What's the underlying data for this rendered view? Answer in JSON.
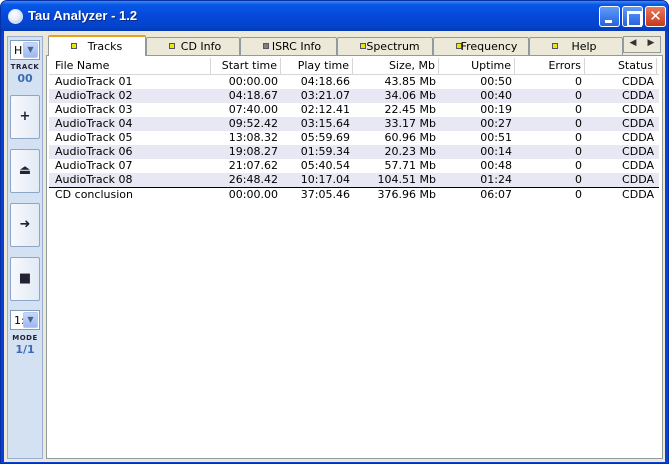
{
  "window": {
    "title": "Tau Analyzer - 1.2"
  },
  "titlebar": {
    "close_glyph": "✕"
  },
  "side": {
    "track_combo": "H",
    "track_label": "TRACK",
    "track_value": "00",
    "buttons": [
      {
        "glyph": "+",
        "icon": "plus-icon"
      },
      {
        "glyph": "⏏",
        "icon": "eject-icon"
      },
      {
        "glyph": "➜",
        "icon": "next-arrow-icon"
      },
      {
        "glyph": "■",
        "icon": "stop-icon"
      }
    ],
    "mode_combo": "1:",
    "mode_label": "MODE",
    "mode_value": "1/1"
  },
  "tabs": [
    {
      "label": "Tracks",
      "indicator": "#e8e800",
      "active": true
    },
    {
      "label": "CD Info",
      "indicator": "#e8e800"
    },
    {
      "label": "ISRC Info",
      "indicator": "#808080"
    },
    {
      "label": "Spectrum",
      "indicator": "#e8e800"
    },
    {
      "label": "Frequency",
      "indicator": "#e8e800"
    },
    {
      "label": "Help",
      "indicator": "#e8e800"
    }
  ],
  "tab_scroll": {
    "left": "◀",
    "right": "▶"
  },
  "table": {
    "columns": [
      "File Name",
      "Start time",
      "Play time",
      "Size, Mb",
      "Uptime",
      "Errors",
      "Status"
    ],
    "rows": [
      [
        "AudioTrack 01",
        "00:00.00",
        "04:18.66",
        "43.85 Mb",
        "00:50",
        "0",
        "CDDA"
      ],
      [
        "AudioTrack 02",
        "04:18.67",
        "03:21.07",
        "34.06 Mb",
        "00:40",
        "0",
        "CDDA"
      ],
      [
        "AudioTrack 03",
        "07:40.00",
        "02:12.41",
        "22.45 Mb",
        "00:19",
        "0",
        "CDDA"
      ],
      [
        "AudioTrack 04",
        "09:52.42",
        "03:15.64",
        "33.17 Mb",
        "00:27",
        "0",
        "CDDA"
      ],
      [
        "AudioTrack 05",
        "13:08.32",
        "05:59.69",
        "60.96 Mb",
        "00:51",
        "0",
        "CDDA"
      ],
      [
        "AudioTrack 06",
        "19:08.27",
        "01:59.34",
        "20.23 Mb",
        "00:14",
        "0",
        "CDDA"
      ],
      [
        "AudioTrack 07",
        "21:07.62",
        "05:40.54",
        "57.71 Mb",
        "00:48",
        "0",
        "CDDA"
      ],
      [
        "AudioTrack 08",
        "26:48.42",
        "10:17.04",
        "104.51 Mb",
        "01:24",
        "0",
        "CDDA"
      ]
    ],
    "summary": [
      "CD conclusion",
      "00:00.00",
      "37:05.46",
      "376.96 Mb",
      "06:07",
      "0",
      "CDDA"
    ]
  }
}
